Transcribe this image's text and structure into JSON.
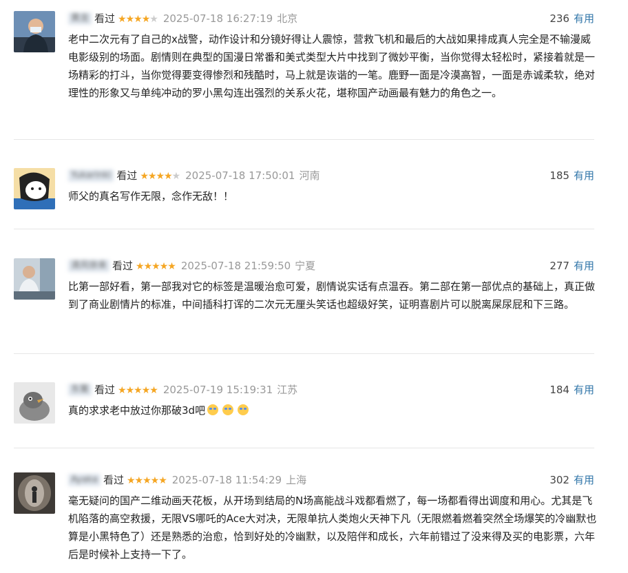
{
  "reviews": [
    {
      "username": "黄龙",
      "status": "看过",
      "stars": 4,
      "date": "2025-07-18 16:27:19",
      "location": "北京",
      "useful_count": "236",
      "useful_label": "有用",
      "text": "老中二次元有了自己的x战警，动作设计和分镜好得让人震惊，营救飞机和最后的大战如果排成真人完全是不输漫威电影级别的场面。剧情则在典型的国漫日常番和美式类型大片中找到了微妙平衡，当你觉得太轻松时，紧接着就是一场精彩的打斗，当你觉得要变得惨烈和残酷时，马上就是诙谐的一笔。鹿野一面是冷漠高智，一面是赤诚柔软，绝对理性的形象又与单纯冲动的罗小黑勾连出强烈的关系火花，堪称国产动画最有魅力的角色之一。",
      "avatar_icon": "user-photo-icon"
    },
    {
      "username": "Yukarinki",
      "status": "看过",
      "stars": 4,
      "date": "2025-07-18 17:50:01",
      "location": "河南",
      "useful_count": "185",
      "useful_label": "有用",
      "text": "师父的真名写作无限，念作无敌！！",
      "avatar_icon": "cartoon-avatar-icon"
    },
    {
      "username": "清风徐来",
      "status": "看过",
      "stars": 5,
      "date": "2025-07-18 21:59:50",
      "location": "宁夏",
      "useful_count": "277",
      "useful_label": "有用",
      "text": "比第一部好看，第一部我对它的标签是温暖治愈可爱，剧情说实话有点温吞。第二部在第一部优点的基础上，真正做到了商业剧情片的标准，中间插科打诨的二次元无厘头笑话也超级好笑，证明喜剧片可以脱离屎尿屁和下三路。",
      "avatar_icon": "user-photo-icon"
    },
    {
      "username": "东篱",
      "status": "看过",
      "stars": 5,
      "date": "2025-07-19 15:19:31",
      "location": "江苏",
      "useful_count": "184",
      "useful_label": "有用",
      "text": "真的求求老中放过你那破3d吧",
      "emoji_count": 3,
      "avatar_icon": "bird-avatar-icon"
    },
    {
      "username": "Ayaka",
      "status": "看过",
      "stars": 5,
      "date": "2025-07-18 11:54:29",
      "location": "上海",
      "useful_count": "302",
      "useful_label": "有用",
      "text": "毫无疑问的国产二维动画天花板，从开场到结局的N场高能战斗戏都看燃了，每一场都看得出调度和用心。尤其是飞机陷落的高空救援，无限VS哪吒的Ace大对决，无限单抗人类炮火天神下凡（无限燃着燃着突然全场爆笑的冷幽默也算是小黑特色了）还是熟悉的治愈，恰到好处的冷幽默，以及陪伴和成长，六年前错过了没来得及买的电影票，六年后是时候补上支持一下了。",
      "avatar_icon": "user-photo-icon"
    }
  ]
}
